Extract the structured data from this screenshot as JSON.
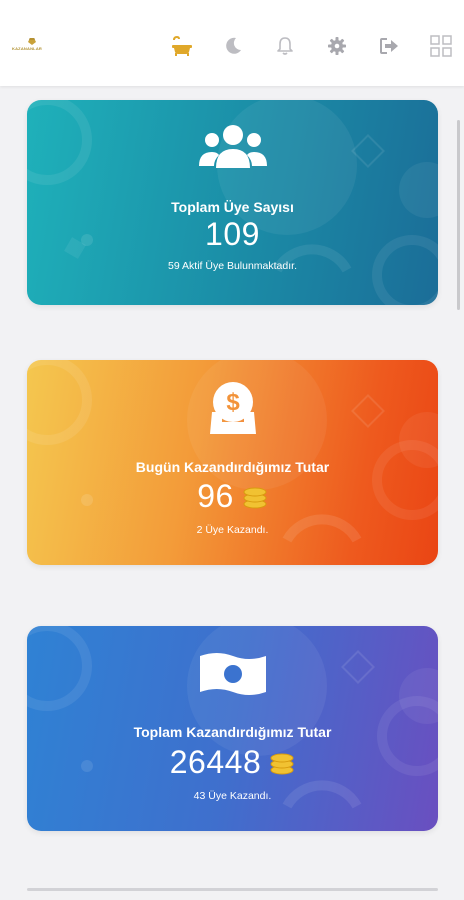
{
  "header": {
    "logo_text": "KAZANANLAR",
    "icons": [
      "bathtub-icon",
      "moon-icon",
      "bell-icon",
      "gear-icon",
      "logout-icon",
      "grid-icon"
    ],
    "accent_color": "#d9a227"
  },
  "cards": [
    {
      "title": "Toplam Üye Sayısı",
      "value": "109",
      "subtitle": "59 Aktif Üye Bulunmaktadır.",
      "icon": "users-icon"
    },
    {
      "title": "Bugün Kazandırdığımız Tutar",
      "value": "96",
      "subtitle": "2 Üye Kazandı.",
      "icon": "money-bag-icon",
      "value_icon": "coins-icon"
    },
    {
      "title": "Toplam Kazandırdığımız Tutar",
      "value": "26448",
      "subtitle": "43 Üye Kazandı.",
      "icon": "banknote-icon",
      "value_icon": "coins-icon"
    }
  ]
}
